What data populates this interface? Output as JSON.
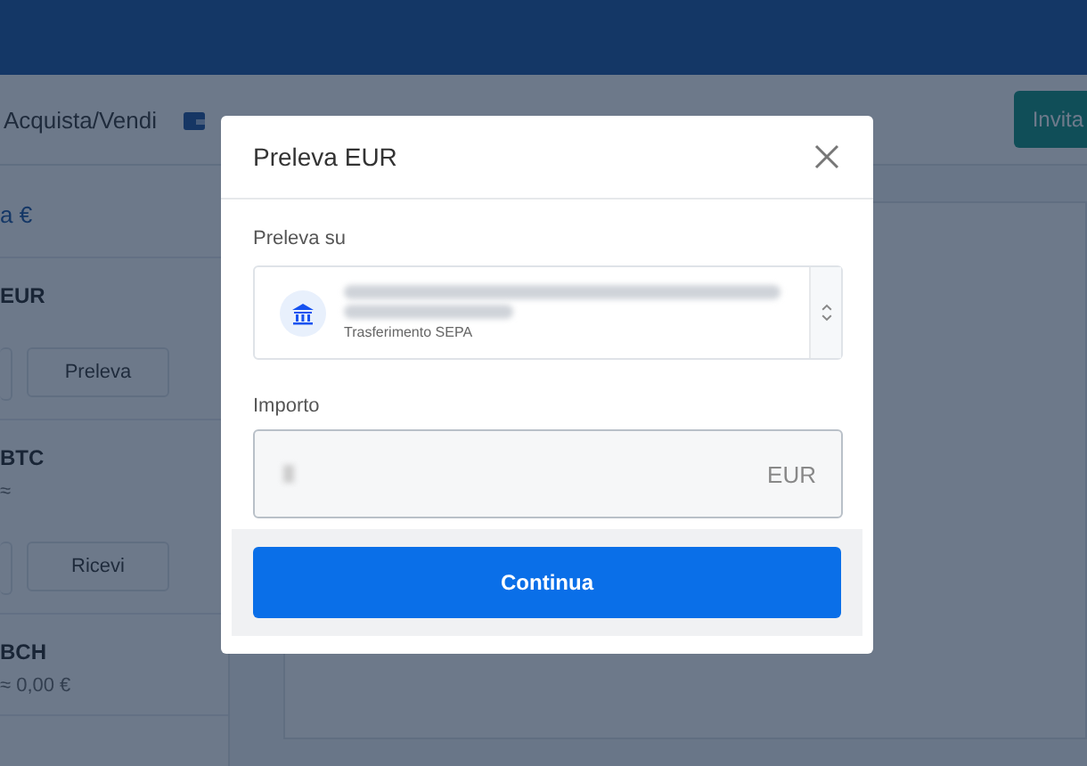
{
  "page": {
    "nav": {
      "tab": "Acquista/Vendi",
      "invite_button": "Invita"
    },
    "accounts": [
      {
        "balance": "a €"
      },
      {
        "currency": "EUR",
        "action": "Preleva"
      },
      {
        "currency": "BTC",
        "approx": "≈",
        "action": "Ricevi"
      },
      {
        "currency": "BCH",
        "approx": "≈ 0,00 €"
      }
    ]
  },
  "modal": {
    "title": "Preleva EUR",
    "account_label": "Preleva su",
    "account_method": "Trasferimento SEPA",
    "amount_label": "Importo",
    "amount_currency": "EUR",
    "submit_button": "Continua"
  }
}
